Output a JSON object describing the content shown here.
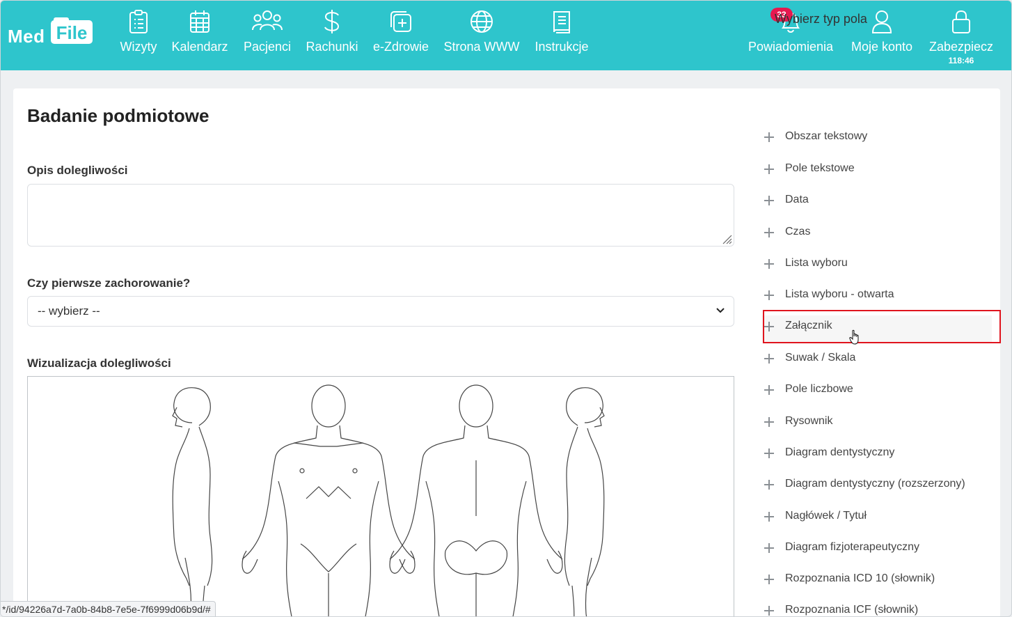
{
  "logo": {
    "med": "Med",
    "file": "File"
  },
  "nav": {
    "items": [
      {
        "label": "Wizyty",
        "icon": "clipboard-icon"
      },
      {
        "label": "Kalendarz",
        "icon": "calendar-icon"
      },
      {
        "label": "Pacjenci",
        "icon": "users-icon"
      },
      {
        "label": "Rachunki",
        "icon": "dollar-icon"
      },
      {
        "label": "e-Zdrowie",
        "icon": "medical-plus-icon"
      },
      {
        "label": "Strona WWW",
        "icon": "globe-icon"
      },
      {
        "label": "Instrukcje",
        "icon": "book-icon"
      }
    ],
    "right": {
      "notifications": {
        "label": "Powiadomienia",
        "badge": "33",
        "icon": "bell-icon"
      },
      "account": {
        "label": "Moje konto",
        "icon": "user-icon"
      },
      "lock": {
        "label": "Zabezpiecz",
        "timer": "118:46",
        "icon": "lock-icon"
      }
    }
  },
  "colors": {
    "brand": "#2ec5cc",
    "badge": "#e6194f",
    "highlight": "#e0141e"
  },
  "form": {
    "title": "Badanie podmiotowe",
    "fields": {
      "description_label": "Opis dolegliwości",
      "description_value": "",
      "first_illness_label": "Czy pierwsze zachorowanie?",
      "first_illness_value": "-- wybierz --",
      "visualization_label": "Wizualizacja dolegliwości"
    }
  },
  "panel": {
    "title": "Wybierz typ pola",
    "items": [
      "Obszar tekstowy",
      "Pole tekstowe",
      "Data",
      "Czas",
      "Lista wyboru",
      "Lista wyboru - otwarta",
      "Załącznik",
      "Suwak / Skala",
      "Pole liczbowe",
      "Rysownik",
      "Diagram dentystyczny",
      "Diagram dentystyczny (rozszerzony)",
      "Nagłówek / Tytuł",
      "Diagram fizjoterapeutyczny",
      "Rozpoznania ICD 10 (słownik)",
      "Rozpoznania ICF (słownik)"
    ],
    "highlighted_item": "Załącznik"
  },
  "status_url": "*/id/94226a7d-7a0b-84b8-7e5e-7f6999d06b9d/#"
}
